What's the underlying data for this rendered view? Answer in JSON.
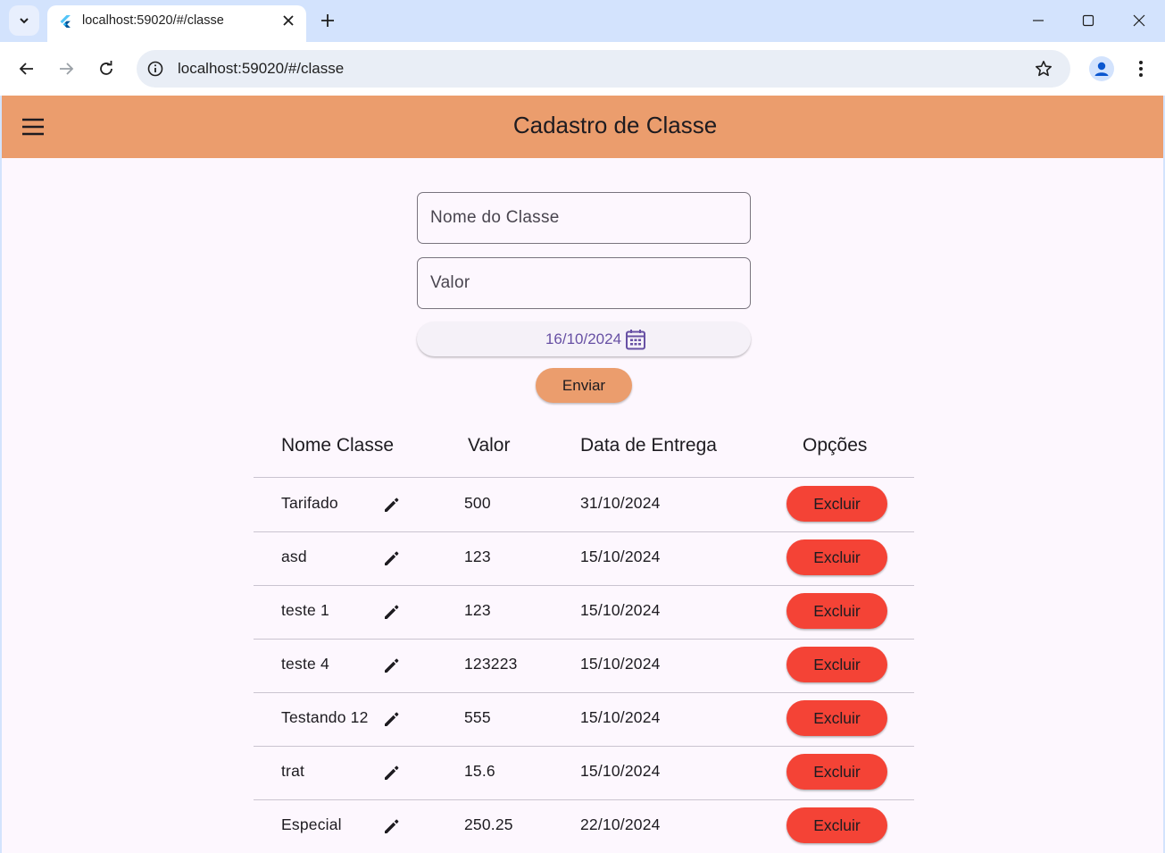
{
  "browser": {
    "tab_title": "localhost:59020/#/classe",
    "url": "localhost:59020/#/classe"
  },
  "appbar": {
    "title": "Cadastro de Classe"
  },
  "form": {
    "name_placeholder": "Nome do Classe",
    "value_placeholder": "Valor",
    "date": "16/10/2024",
    "submit_label": "Enviar"
  },
  "table": {
    "headers": [
      "Nome Classe",
      "Valor",
      "Data de Entrega",
      "Opções"
    ],
    "rows": [
      {
        "name": "Tarifado",
        "value": "500",
        "date": "31/10/2024",
        "action": "Excluir"
      },
      {
        "name": "asd",
        "value": "123",
        "date": "15/10/2024",
        "action": "Excluir"
      },
      {
        "name": "teste 1",
        "value": "123",
        "date": "15/10/2024",
        "action": "Excluir"
      },
      {
        "name": "teste 4",
        "value": "123223",
        "date": "15/10/2024",
        "action": "Excluir"
      },
      {
        "name": "Testando 12",
        "value": "555",
        "date": "15/10/2024",
        "action": "Excluir"
      },
      {
        "name": "trat",
        "value": "15.6",
        "date": "15/10/2024",
        "action": "Excluir"
      },
      {
        "name": "Especial",
        "value": "250.25",
        "date": "22/10/2024",
        "action": "Excluir"
      }
    ]
  },
  "colors": {
    "appbar": "#eb9d6d",
    "delete_button": "#f44336",
    "date_text": "#6750a4",
    "page_background": "#fdf7fe"
  },
  "icons": {
    "tab_list": "chevron-down-icon",
    "favicon": "flutter-icon",
    "tab_close": "close-icon",
    "new_tab": "plus-icon",
    "minimize": "minimize-icon",
    "maximize": "maximize-icon",
    "close_window": "close-icon",
    "back": "arrow-left-icon",
    "forward": "arrow-right-icon",
    "reload": "reload-icon",
    "site_info": "info-icon",
    "bookmark": "star-icon",
    "profile": "person-icon",
    "browser_menu": "more-vert-icon",
    "drawer_menu": "hamburger-menu-icon",
    "date_picker": "calendar-icon",
    "edit": "pencil-icon"
  }
}
